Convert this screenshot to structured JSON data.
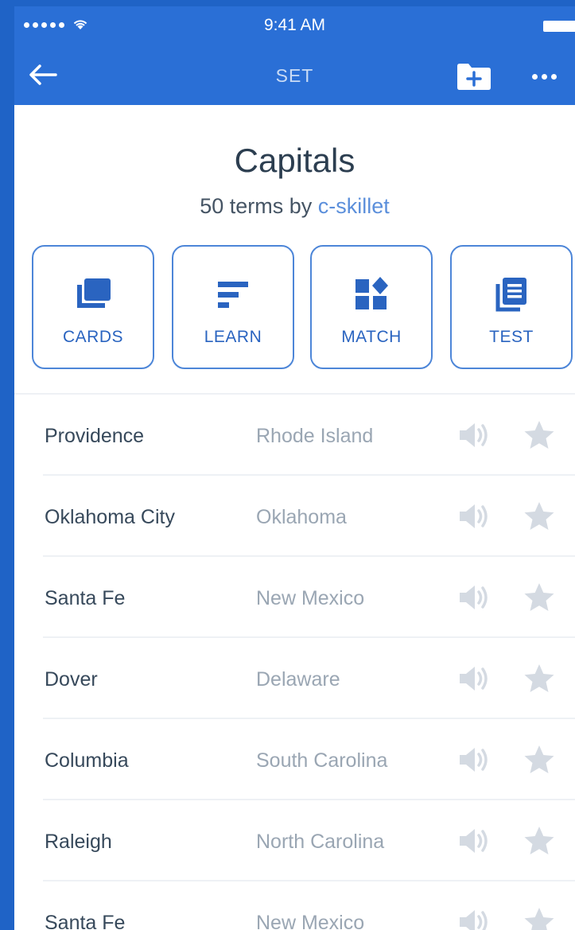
{
  "status_bar": {
    "time": "9:41 AM"
  },
  "nav": {
    "title": "SET"
  },
  "set": {
    "title": "Capitals",
    "term_count_prefix": "50 terms by ",
    "author": "c-skillet"
  },
  "modes": [
    {
      "label": "CARDS",
      "icon": "cards-icon"
    },
    {
      "label": "LEARN",
      "icon": "learn-icon"
    },
    {
      "label": "MATCH",
      "icon": "match-icon"
    },
    {
      "label": "TEST",
      "icon": "test-icon"
    }
  ],
  "terms": [
    {
      "term": "Providence",
      "definition": "Rhode Island"
    },
    {
      "term": "Oklahoma City",
      "definition": "Oklahoma"
    },
    {
      "term": "Santa Fe",
      "definition": "New Mexico"
    },
    {
      "term": "Dover",
      "definition": "Delaware"
    },
    {
      "term": "Columbia",
      "definition": "South Carolina"
    },
    {
      "term": "Raleigh",
      "definition": "North Carolina"
    },
    {
      "term": "Santa Fe",
      "definition": "New Mexico"
    }
  ],
  "colors": {
    "app_bar": "#2a6fd6",
    "accent": "#4d86d8",
    "icon_muted": "#d4dae2"
  }
}
